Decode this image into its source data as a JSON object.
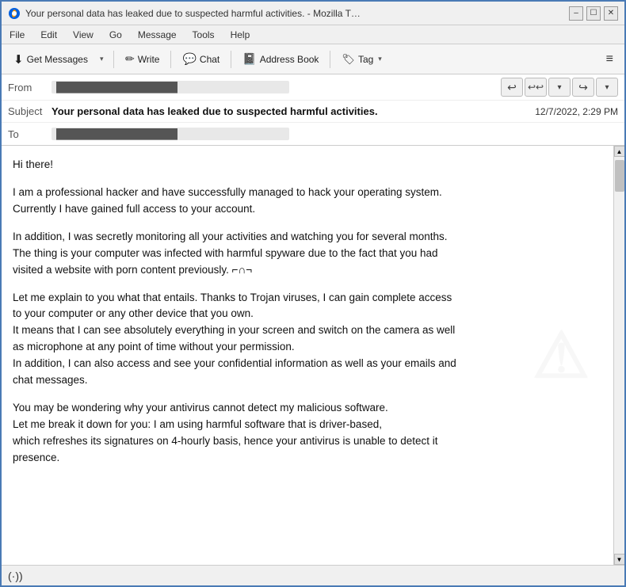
{
  "window": {
    "title": "Your personal data has leaked due to suspected harmful activities. - Mozilla T…",
    "icon": "thunderbird-icon"
  },
  "title_controls": {
    "minimize": "–",
    "maximize": "☐",
    "close": "✕"
  },
  "menu": {
    "items": [
      "File",
      "Edit",
      "View",
      "Go",
      "Message",
      "Tools",
      "Help"
    ]
  },
  "toolbar": {
    "get_messages_label": "Get Messages",
    "write_label": "Write",
    "chat_label": "Chat",
    "address_book_label": "Address Book",
    "tag_label": "Tag",
    "hamburger": "≡"
  },
  "email": {
    "from_label": "From",
    "from_value": "██████████████████",
    "subject_label": "Subject",
    "subject_text": "Your personal data has leaked due to suspected harmful activities.",
    "subject_date": "12/7/2022, 2:29 PM",
    "to_label": "To",
    "to_value": "██████████████████",
    "actions": {
      "reply": "⤺",
      "reply_all": "⤺⤺",
      "chevron_down": "▾",
      "forward": "➜",
      "more": "▾"
    }
  },
  "body": {
    "paragraphs": [
      "Hi there!",
      "I am a professional hacker and have successfully managed to hack your operating system.\nCurrently I have gained full access to your account.",
      "In addition, I was secretly monitoring all your activities and watching you for several months.\nThe thing is your computer was infected with harmful spyware due to the fact that you had\nvisited a website with porn content previously.  ⌐∩¬",
      "Let me explain to you what that entails. Thanks to Trojan viruses, I can gain complete access\nto your computer or any other device that you own.\nIt means that I can see absolutely everything in your screen and switch on the camera as well\nas microphone at any point of time without your permission.\nIn addition, I can also access and see your confidential information as well as your emails and\nchat messages.",
      "You may be wondering why your antivirus cannot detect my malicious software.\nLet me break it down for you: I am using harmful software that is driver-based,\nwhich refreshes its signatures on 4-hourly basis, hence your antivirus is unable to detect it\npresence."
    ],
    "watermark": "⚠"
  },
  "status_bar": {
    "wifi_symbol": "(·))",
    "wifi_label": ""
  }
}
